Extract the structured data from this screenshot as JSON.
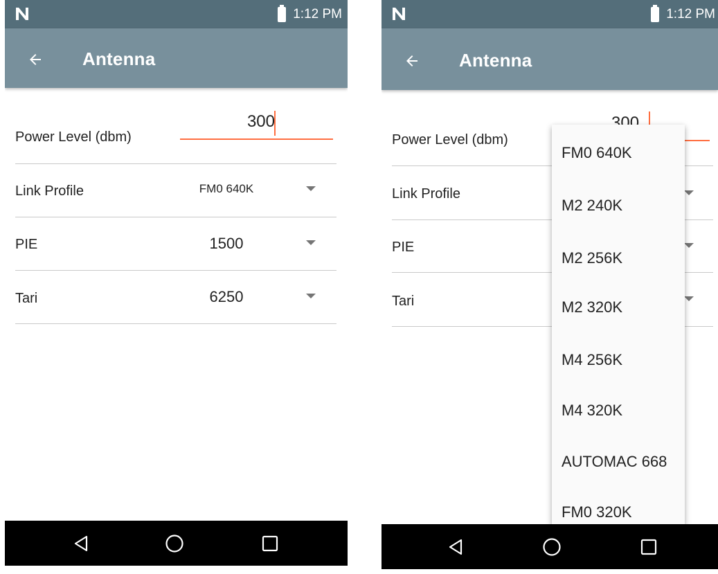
{
  "status_bar": {
    "time": "1:12 PM"
  },
  "app_bar": {
    "title": "Antenna"
  },
  "settings": {
    "power_level": {
      "label": "Power Level (dbm)",
      "value": "300"
    },
    "link_profile": {
      "label": "Link Profile",
      "value": "FM0 640K"
    },
    "pie": {
      "label": "PIE",
      "value": "1500"
    },
    "tari": {
      "label": "Tari",
      "value": "6250"
    }
  },
  "link_profile_dropdown": {
    "options": [
      "FM0 640K",
      "M2 240K",
      "M2 256K",
      "M2 320K",
      "M4 256K",
      "M4 320K",
      "AUTOMAC 668",
      "FM0 320K"
    ]
  },
  "icons": {
    "status": [
      "network-n-icon",
      "battery-icon"
    ],
    "app_bar": [
      "back-arrow-icon"
    ],
    "navigation": [
      "back-triangle-icon",
      "home-circle-icon",
      "recents-square-icon"
    ],
    "spinner": "dropdown-caret-icon"
  },
  "colors": {
    "status_bar": "#546e7a",
    "app_bar": "#78909c",
    "accent": "#ff6e40",
    "nav_bar": "#000000"
  }
}
